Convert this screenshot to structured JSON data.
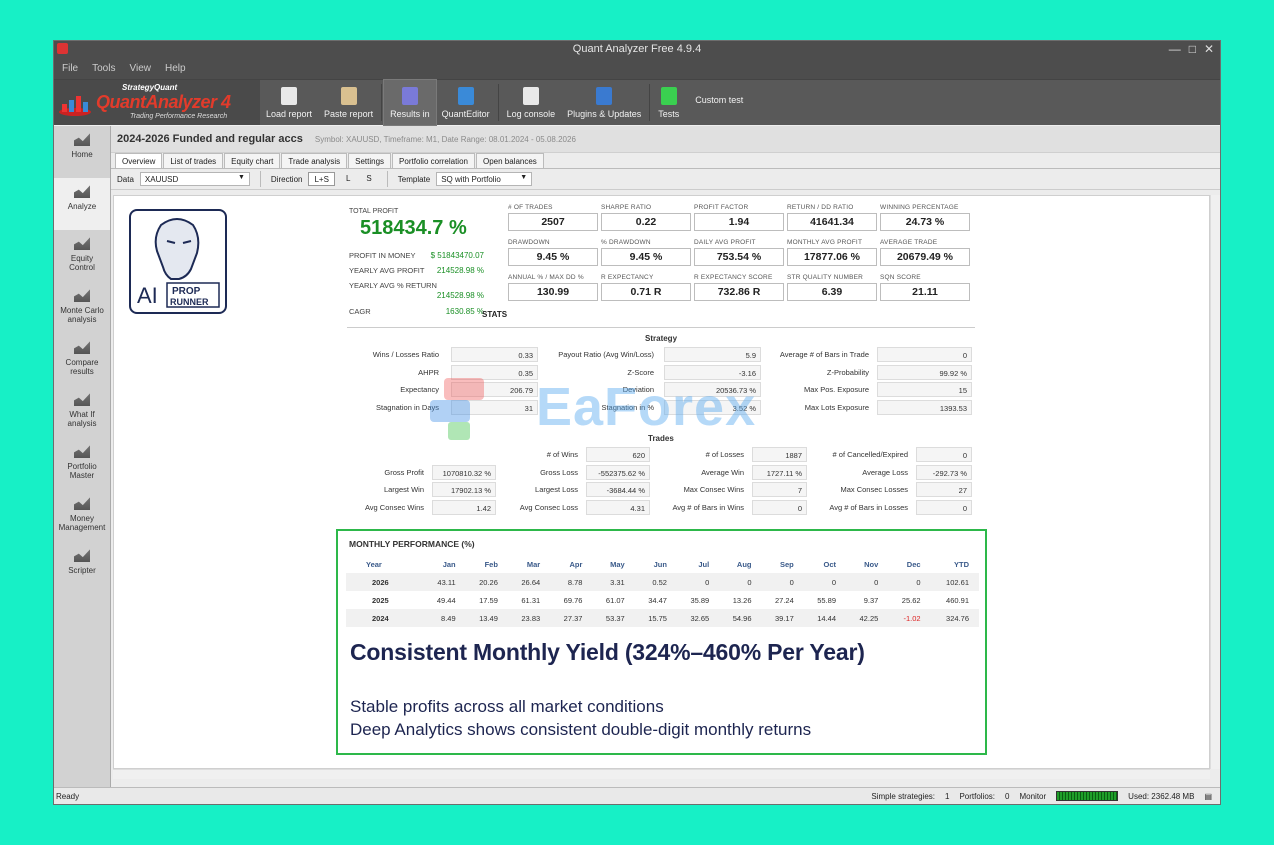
{
  "window": {
    "title": "Quant Analyzer Free 4.9.4",
    "controls": [
      "—",
      "□",
      "✕"
    ]
  },
  "menu": [
    "File",
    "Tools",
    "View",
    "Help"
  ],
  "logo": {
    "line1": "StrategyQuant",
    "line2": "QuantAnalyzer 4",
    "line3": "Trading Performance   Research"
  },
  "toolbar": [
    {
      "label": "Load report",
      "icon": "file-icon",
      "color": "#e8e8e8"
    },
    {
      "label": "Paste report",
      "icon": "clipboard-icon",
      "color": "#d9c090"
    },
    {
      "label": "Results in",
      "icon": "results-icon",
      "color": "#7a7ad8"
    },
    {
      "label": "QuantEditor",
      "icon": "globe-icon",
      "color": "#3a8ad8"
    },
    {
      "label": "Log console",
      "icon": "console-icon",
      "color": "#e8e8e8"
    },
    {
      "label": "Plugins & Updates",
      "icon": "puzzle-icon",
      "color": "#3a7ad0"
    },
    {
      "label": "Tests",
      "icon": "checkmark-icon",
      "color": "#3ad050"
    },
    {
      "label": "Custom test",
      "icon": "",
      "color": ""
    }
  ],
  "sidebar": [
    {
      "label": "Home",
      "icon": "home-icon"
    },
    {
      "label": "Analyze",
      "icon": "analyze-icon"
    },
    {
      "label": "Equity\nControl",
      "icon": "equity-control-icon"
    },
    {
      "label": "Monte Carlo\nanalysis",
      "icon": "monte-carlo-icon"
    },
    {
      "label": "Compare\nresults",
      "icon": "compare-icon"
    },
    {
      "label": "What If\nanalysis",
      "icon": "what-if-icon"
    },
    {
      "label": "Portfolio\nMaster",
      "icon": "portfolio-icon"
    },
    {
      "label": "Money\nManagement",
      "icon": "money-icon"
    },
    {
      "label": "Scripter",
      "icon": "scripter-icon"
    }
  ],
  "strategy": {
    "name": "2024-2026 Funded and regular accs",
    "meta": "Symbol: XAUUSD, Timeframe: M1, Date Range: 08.01.2024 - 05.08.2026"
  },
  "tabs": [
    "Overview",
    "List of trades",
    "Equity chart",
    "Trade analysis",
    "Settings",
    "Portfolio correlation",
    "Open balances"
  ],
  "filters": {
    "data_label": "Data",
    "data_value": "XAUUSD",
    "direction_label": "Direction",
    "directions": [
      "L+S",
      "L",
      "S"
    ],
    "template_label": "Template",
    "template_value": "SQ with Portfolio"
  },
  "avatar_text": {
    "ai": "AI",
    "prop": "PROP",
    "runner": "RUNNER"
  },
  "summary": {
    "total_profit_label": "TOTAL PROFIT",
    "total_profit": "518434.7 %",
    "profit_in_money_label": "PROFIT IN MONEY",
    "profit_in_money": "$ 51843470.07",
    "yearly_avg_profit_label": "YEARLY AVG PROFIT",
    "yearly_avg_profit": "214528.98 %",
    "yearly_avg_return_label": "YEARLY AVG % RETURN",
    "yearly_avg_return": "214528.98 %",
    "cagr_label": "CAGR",
    "cagr": "1630.85 %"
  },
  "kpis": [
    {
      "label": "# OF TRADES",
      "value": "2507"
    },
    {
      "label": "SHARPE RATIO",
      "value": "0.22"
    },
    {
      "label": "PROFIT FACTOR",
      "value": "1.94"
    },
    {
      "label": "RETURN / DD RATIO",
      "value": "41641.34"
    },
    {
      "label": "WINNING PERCENTAGE",
      "value": "24.73 %"
    },
    {
      "label": "DRAWDOWN",
      "value": "9.45 %"
    },
    {
      "label": "% DRAWDOWN",
      "value": "9.45 %"
    },
    {
      "label": "DAILY AVG PROFIT",
      "value": "753.54 %"
    },
    {
      "label": "MONTHLY AVG PROFIT",
      "value": "17877.06 %"
    },
    {
      "label": "AVERAGE TRADE",
      "value": "20679.49 %"
    },
    {
      "label": "ANNUAL % / MAX DD %",
      "value": "130.99"
    },
    {
      "label": "R EXPECTANCY",
      "value": "0.71 R"
    },
    {
      "label": "R EXPECTANCY SCORE",
      "value": "732.86 R"
    },
    {
      "label": "STR QUALITY NUMBER",
      "value": "6.39"
    },
    {
      "label": "SQN SCORE",
      "value": "21.11"
    }
  ],
  "stats_title": "STATS",
  "strategy_section": {
    "title": "Strategy",
    "rows": [
      [
        [
          "Wins / Losses Ratio",
          "0.33"
        ],
        [
          "Payout Ratio (Avg Win/Loss)",
          "5.9"
        ],
        [
          "Average # of Bars in Trade",
          "0"
        ]
      ],
      [
        [
          "AHPR",
          "0.35"
        ],
        [
          "Z-Score",
          "-3.16"
        ],
        [
          "Z-Probability",
          "99.92 %"
        ]
      ],
      [
        [
          "Expectancy",
          "206.79"
        ],
        [
          "Deviation",
          "20536.73 %"
        ],
        [
          "Max Pos. Exposure",
          "15"
        ]
      ],
      [
        [
          "Stagnation in Days",
          "31"
        ],
        [
          "Stagnation in %",
          "3.52 %"
        ],
        [
          "Max Lots Exposure",
          "1393.53"
        ]
      ]
    ]
  },
  "trades_section": {
    "title": "Trades",
    "rows": [
      [
        [
          "",
          ""
        ],
        [
          "# of Wins",
          "620"
        ],
        [
          "# of Losses",
          "1887"
        ],
        [
          "# of Cancelled/Expired",
          "0"
        ]
      ],
      [
        [
          "Gross Profit",
          "1070810.32 %"
        ],
        [
          "Gross Loss",
          "-552375.62 %"
        ],
        [
          "Average Win",
          "1727.11 %"
        ],
        [
          "Average Loss",
          "-292.73 %"
        ]
      ],
      [
        [
          "Largest Win",
          "17902.13 %"
        ],
        [
          "Largest Loss",
          "-3684.44 %"
        ],
        [
          "Max Consec Wins",
          "7"
        ],
        [
          "Max Consec Losses",
          "27"
        ]
      ],
      [
        [
          "Avg Consec Wins",
          "1.42"
        ],
        [
          "Avg Consec Loss",
          "4.31"
        ],
        [
          "Avg # of Bars in Wins",
          "0"
        ],
        [
          "Avg # of Bars in Losses",
          "0"
        ]
      ]
    ]
  },
  "monthly": {
    "title": "MONTHLY PERFORMANCE (%)",
    "headers": [
      "Year",
      "Jan",
      "Feb",
      "Mar",
      "Apr",
      "May",
      "Jun",
      "Jul",
      "Aug",
      "Sep",
      "Oct",
      "Nov",
      "Dec",
      "YTD"
    ],
    "rows": [
      [
        "2026",
        "43.11",
        "20.26",
        "26.64",
        "8.78",
        "3.31",
        "0.52",
        "0",
        "0",
        "0",
        "0",
        "0",
        "0",
        "102.61"
      ],
      [
        "2025",
        "49.44",
        "17.59",
        "61.31",
        "69.76",
        "61.07",
        "34.47",
        "35.89",
        "13.26",
        "27.24",
        "55.89",
        "9.37",
        "25.62",
        "460.91"
      ],
      [
        "2024",
        "8.49",
        "13.49",
        "23.83",
        "27.37",
        "53.37",
        "15.75",
        "32.65",
        "54.96",
        "39.17",
        "14.44",
        "42.25",
        "-1.02",
        "324.76"
      ]
    ],
    "headline": "Consistent Monthly Yield (324%–460% Per Year)",
    "sub1": "Stable profits across all market conditions",
    "sub2": "Deep Analytics shows consistent double-digit monthly returns"
  },
  "watermark": "EaForex",
  "status": {
    "left": "Ready",
    "simple_label": "Simple strategies:",
    "simple_value": "1",
    "portfolios_label": "Portfolios:",
    "portfolios_value": "0",
    "monitor_label": "Monitor",
    "used": "Used: 2362.48 MB"
  }
}
